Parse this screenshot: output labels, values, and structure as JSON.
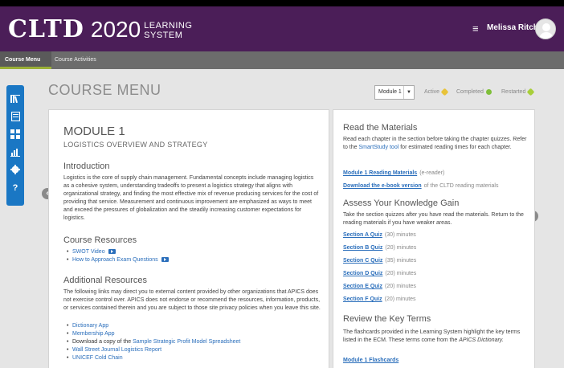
{
  "header": {
    "logo_main": "CLTD",
    "logo_year": "2020",
    "logo_line1": "LEARNING",
    "logo_line2": "SYSTEM",
    "menu_icon": "hamburger-icon",
    "username": "Melissa Ritchie",
    "avatar_icon": "user-avatar-icon"
  },
  "subnav": {
    "tab_course_menu": "Course Menu",
    "tab_course_activities": "Course Activities"
  },
  "toolbar": {
    "icons": [
      "library-icon",
      "book-icon",
      "flashcards-icon",
      "chart-icon",
      "settings-icon",
      "help-icon"
    ]
  },
  "page": {
    "heading": "COURSE MENU",
    "module_select": "Module 1",
    "legend_active": "Active",
    "legend_completed": "Completed",
    "legend_restarted": "Restarted",
    "colors": {
      "active": "#e8c33a",
      "completed": "#7fbf3a",
      "restarted": "#a8cf3a"
    }
  },
  "module": {
    "title": "MODULE 1",
    "subtitle": "LOGISTICS OVERVIEW AND STRATEGY",
    "intro_heading": "Introduction",
    "intro_text": "Logistics is the core of supply chain management. Fundamental concepts include managing logistics as a cohesive system, understanding tradeoffs to present a logistics strategy that aligns with organizational strategy, and finding the most effective mix of revenue producing services for the cost of providing that service. Measurement and continuous improvement are emphasized as ways to meet and exceed the pressures of globalization and the steadily increasing customer expectations for logistics.",
    "resources_heading": "Course Resources",
    "resources": [
      "SWOT Video",
      "How to Approach Exam Questions"
    ],
    "additional_heading": "Additional Resources",
    "additional_text": "The following links may direct you to external content provided by other organizations that APICS does not exercise control over. APICS does not endorse or recommend the resources, information, products, or services contained therein and you are subject to those site privacy policies when you leave this site.",
    "additional_links": {
      "dictionary": "Dictionary App",
      "membership": "Membership App",
      "download_prefix": "Download a copy of the",
      "spreadsheet": "Sample Strategic Profit Model Spreadsheet",
      "wsj": "Wall Street Journal Logistics Report",
      "unicef": "UNICEF Cold Chain"
    }
  },
  "right": {
    "read_heading": "Read the Materials",
    "read_text_1": "Read each chapter in the section before taking the chapter quizzes. Refer to the",
    "read_link": "SmartStudy tool",
    "read_text_2": "for estimated reading times for each chapter.",
    "reading_materials": "Module 1 Reading Materials",
    "reading_note": "(e-reader)",
    "ebook": "Download the e-book version",
    "ebook_note": "of the CLTD reading materials",
    "assess_heading": "Assess Your Knowledge Gain",
    "assess_text": "Take the section quizzes after you have read the materials. Return to the reading materials if you have weaker areas.",
    "quizzes": [
      {
        "label": "Section A Quiz",
        "time": "(30) minutes"
      },
      {
        "label": "Section B Quiz",
        "time": "(20) minutes"
      },
      {
        "label": "Section C Quiz",
        "time": "(35) minutes"
      },
      {
        "label": "Section D Quiz",
        "time": "(20) minutes"
      },
      {
        "label": "Section E Quiz",
        "time": "(20) minutes"
      },
      {
        "label": "Section F Quiz",
        "time": "(20) minutes"
      }
    ],
    "terms_heading": "Review the Key Terms",
    "terms_text_1": "The flashcards provided in the Learning System highlight the key terms listed in the ECM. These terms come from the",
    "terms_text_italic": "APICS Dictionary.",
    "flashcards": "Module 1 Flashcards"
  }
}
